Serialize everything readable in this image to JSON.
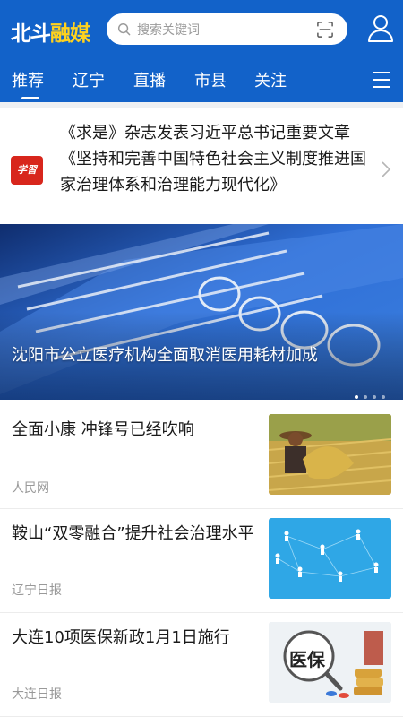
{
  "header": {
    "logo_part1": "北斗",
    "logo_part2": "融媒",
    "search_placeholder": "搜索关键词",
    "brand_color": "#1262c9",
    "logo_accent": "#ffd21e"
  },
  "tabs": [
    {
      "label": "推荐",
      "active": true
    },
    {
      "label": "辽宁",
      "active": false
    },
    {
      "label": "直播",
      "active": false
    },
    {
      "label": "市县",
      "active": false
    },
    {
      "label": "关注",
      "active": false
    }
  ],
  "headline": {
    "badge": "学習",
    "text": "《求是》杂志发表习近平总书记重要文章《坚持和完善中国特色社会主义制度推进国家治理体系和治理能力现代化》"
  },
  "banner": {
    "title": "沈阳市公立医疗机构全面取消医用耗材加成",
    "slide_count": 4,
    "active_slide": 1
  },
  "news": [
    {
      "title": "全面小康 冲锋号已经吹响",
      "source": "人民网",
      "thumb": "farmer-harvest-image"
    },
    {
      "title": "鞍山“双零融合”提升社会治理水平",
      "source": "辽宁日报",
      "thumb": "network-people-image"
    },
    {
      "title": "大连10项医保新政1月1日施行",
      "source": "大连日报",
      "thumb": "medical-insurance-image",
      "thumb_text": "医保"
    }
  ]
}
